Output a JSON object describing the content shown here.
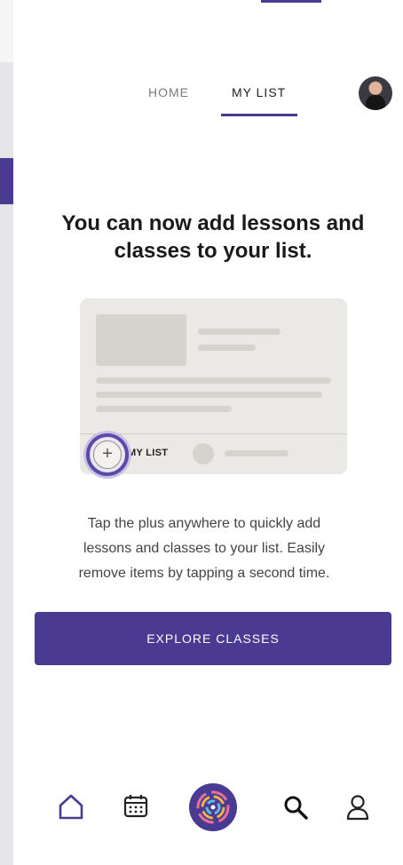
{
  "tabs": {
    "home": "HOME",
    "my_list": "MY LIST",
    "active": "MY LIST"
  },
  "headline": "You can now add lessons and classes to your list.",
  "illustration": {
    "label": "MY LIST",
    "plus_symbol": "+"
  },
  "description": "Tap the plus anywhere to quickly add lessons and classes to your list. Easily remove items by tapping a second time.",
  "cta_label": "EXPLORE CLASSES",
  "bottom_nav": {
    "items": [
      "home-icon",
      "calendar-icon",
      "app-logo-icon",
      "search-icon",
      "profile-icon"
    ],
    "active": "home-icon"
  },
  "colors": {
    "accent": "#4a3a92",
    "illustration_bg": "#ebe9e5",
    "text": "#1a1a1a"
  }
}
